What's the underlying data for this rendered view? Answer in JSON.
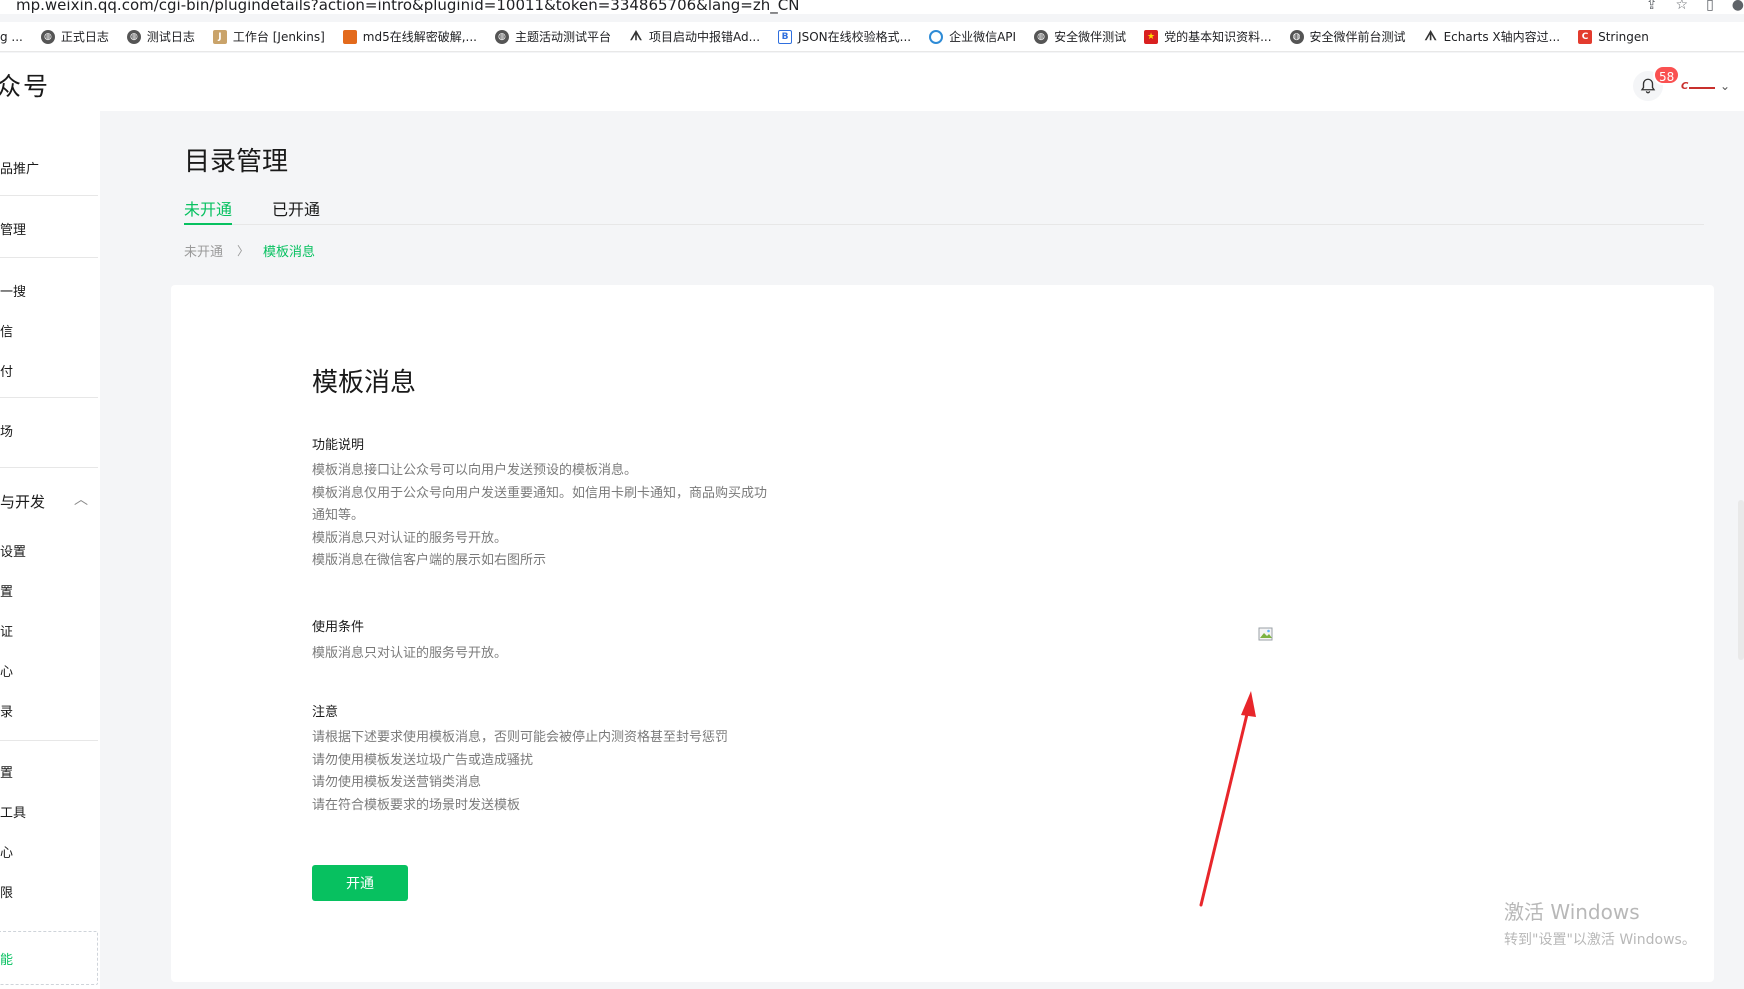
{
  "browser": {
    "url": "mp.weixin.qq.com/cgi-bin/plugindetails?action=intro&pluginid=10011&token=334865706&lang=zh_CN",
    "bookmarks": [
      {
        "label": "g ...",
        "icon": "none"
      },
      {
        "label": "正式日志",
        "icon": "globe"
      },
      {
        "label": "测试日志",
        "icon": "globe"
      },
      {
        "label": "工作台 [Jenkins]",
        "icon": "person"
      },
      {
        "label": "md5在线解密破解,...",
        "icon": "orange"
      },
      {
        "label": "主题活动测试平台",
        "icon": "globe"
      },
      {
        "label": "项目启动中报错Ad...",
        "icon": "pin"
      },
      {
        "label": "JSON在线校验格式...",
        "icon": "blue"
      },
      {
        "label": "企业微信API",
        "icon": "wechat"
      },
      {
        "label": "安全微伴测试",
        "icon": "globe"
      },
      {
        "label": "党的基本知识资料...",
        "icon": "red"
      },
      {
        "label": "安全微伴前台测试",
        "icon": "globe"
      },
      {
        "label": "Echarts X轴内容过...",
        "icon": "pin"
      },
      {
        "label": "Stringen",
        "icon": "redC"
      }
    ]
  },
  "header": {
    "app_title": "众号",
    "notification_count": "58",
    "avatar_text": "C"
  },
  "sidebar": {
    "items": [
      {
        "label": "品推广"
      },
      {
        "label": "管理"
      },
      {
        "label": "一搜"
      },
      {
        "label": "信"
      },
      {
        "label": "付"
      },
      {
        "label": "场"
      },
      {
        "label": "与开发"
      },
      {
        "label": "设置"
      },
      {
        "label": "置"
      },
      {
        "label": "证"
      },
      {
        "label": "心"
      },
      {
        "label": "录"
      },
      {
        "label": "置"
      },
      {
        "label": "工具"
      },
      {
        "label": "心"
      },
      {
        "label": "限"
      },
      {
        "label": "能"
      }
    ]
  },
  "main": {
    "page_title": "目录管理",
    "tabs": [
      {
        "label": "未开通",
        "active": true
      },
      {
        "label": "已开通",
        "active": false
      }
    ],
    "breadcrumb": {
      "parent": "未开通",
      "current": "模板消息"
    },
    "card": {
      "title": "模板消息",
      "sections": [
        {
          "title": "功能说明",
          "lines": [
            "模板消息接口让公众号可以向用户发送预设的模板消息。",
            "模板消息仅用于公众号向用户发送重要通知。如信用卡刷卡通知，商品购买成功",
            "通知等。",
            "模版消息只对认证的服务号开放。",
            "模版消息在微信客户端的展示如右图所示"
          ]
        },
        {
          "title": "使用条件",
          "lines": [
            "模版消息只对认证的服务号开放。"
          ]
        },
        {
          "title": "注意",
          "lines": [
            "请根据下述要求使用模板消息，否则可能会被停止内测资格甚至封号惩罚",
            "请勿使用模板发送垃圾广告或造成骚扰",
            "请勿使用模板发送营销类消息",
            "请在符合模板要求的场景时发送模板"
          ]
        }
      ],
      "button_label": "开通"
    }
  },
  "watermark": {
    "line1": "激活 Windows",
    "line2": "转到\"设置\"以激活 Windows。"
  },
  "colors": {
    "accent": "#07c160",
    "badge": "#fa5151",
    "arrow": "#e8262b"
  }
}
